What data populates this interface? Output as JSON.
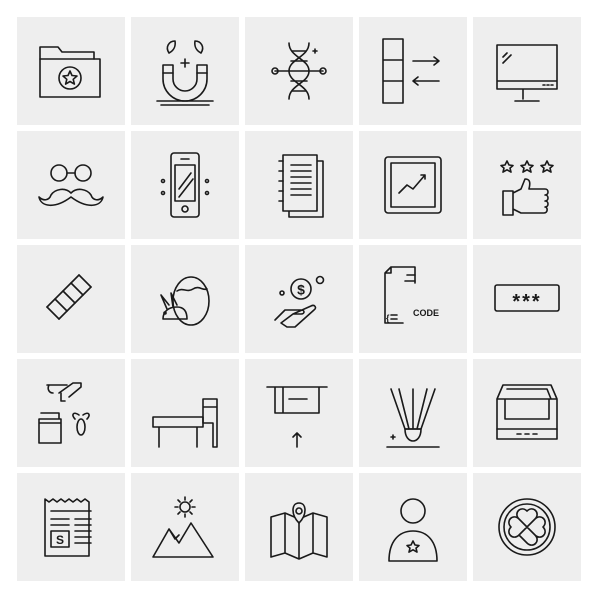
{
  "icons": [
    {
      "name": "folder-star-icon"
    },
    {
      "name": "magnet-leaves-icon"
    },
    {
      "name": "dna-icon"
    },
    {
      "name": "data-transfer-icon"
    },
    {
      "name": "monitor-icon"
    },
    {
      "name": "glasses-mustache-icon"
    },
    {
      "name": "smartphone-icon"
    },
    {
      "name": "documents-icon"
    },
    {
      "name": "stock-chart-icon"
    },
    {
      "name": "thumbs-up-rating-icon"
    },
    {
      "name": "zigzag-pattern-icon"
    },
    {
      "name": "easter-bunny-egg-icon"
    },
    {
      "name": "hand-money-icon"
    },
    {
      "name": "code-file-icon"
    },
    {
      "name": "password-field-icon"
    },
    {
      "name": "honey-bee-icon"
    },
    {
      "name": "school-desk-icon"
    },
    {
      "name": "atm-withdraw-icon"
    },
    {
      "name": "shuttlecock-icon"
    },
    {
      "name": "inbox-tray-icon"
    },
    {
      "name": "newspaper-icon"
    },
    {
      "name": "mountain-sun-icon"
    },
    {
      "name": "map-location-icon"
    },
    {
      "name": "user-badge-icon"
    },
    {
      "name": "button-pattern-icon"
    }
  ],
  "labels": {
    "dollar": "$",
    "code": "CODE",
    "password": "***",
    "news": "S"
  },
  "colors": {
    "tile": "#eeeeee",
    "stroke": "#1a1a1a",
    "background": "#ffffff"
  }
}
